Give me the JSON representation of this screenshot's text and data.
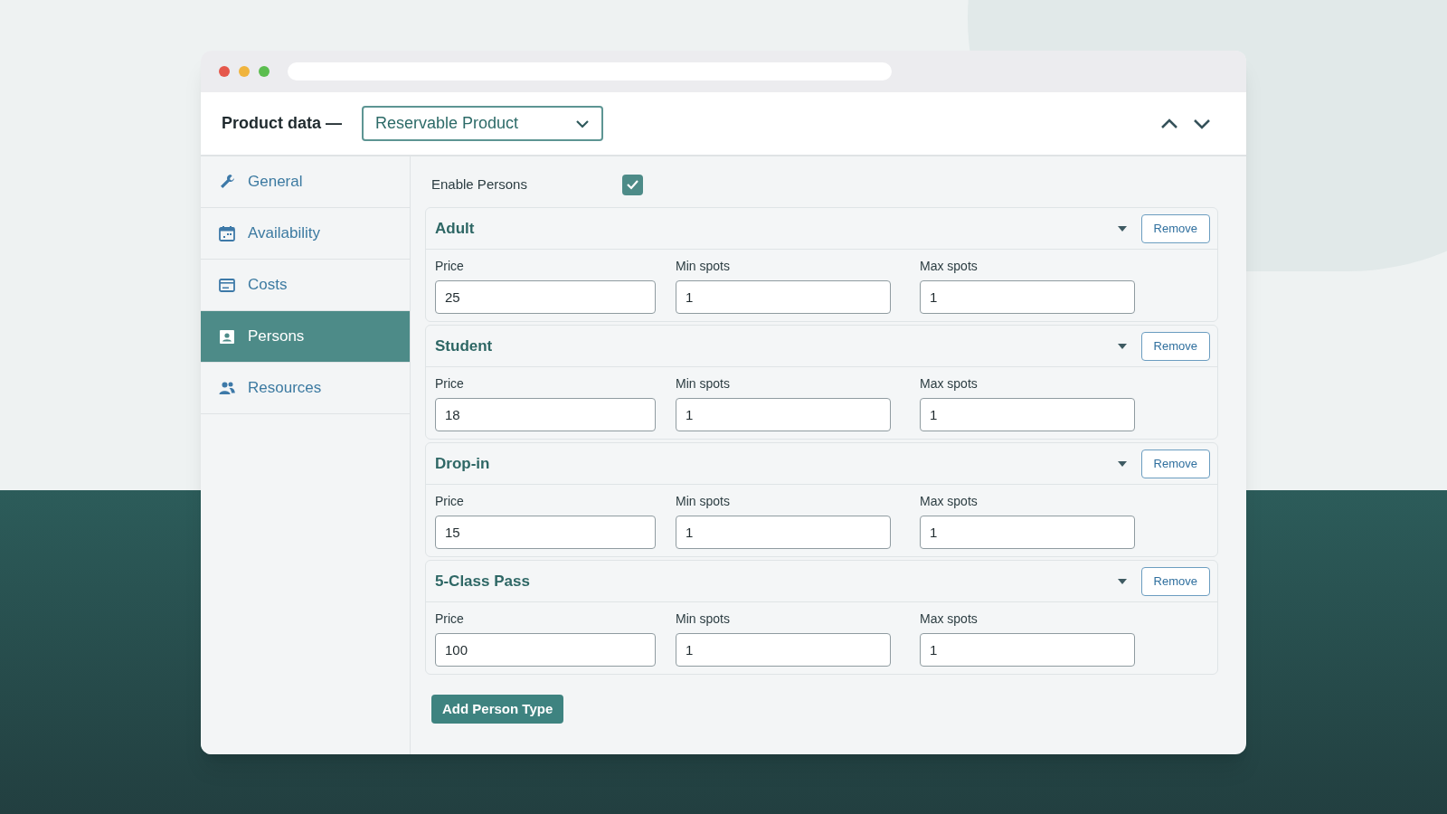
{
  "header": {
    "label": "Product data —",
    "product_type": "Reservable Product"
  },
  "sidebar": {
    "items": [
      {
        "label": "General",
        "selected": false
      },
      {
        "label": "Availability",
        "selected": false
      },
      {
        "label": "Costs",
        "selected": false
      },
      {
        "label": "Persons",
        "selected": true
      },
      {
        "label": "Resources",
        "selected": false
      }
    ]
  },
  "enable_persons": {
    "label": "Enable Persons",
    "checked": true
  },
  "person_types": [
    {
      "name": "Adult",
      "remove": "Remove",
      "fields": [
        {
          "label": "Price",
          "value": "25"
        },
        {
          "label": "Min spots",
          "value": "1"
        },
        {
          "label": "Max spots",
          "value": "1"
        }
      ]
    },
    {
      "name": "Student",
      "remove": "Remove",
      "fields": [
        {
          "label": "Price",
          "value": "18"
        },
        {
          "label": "Min spots",
          "value": "1"
        },
        {
          "label": "Max spots",
          "value": "1"
        }
      ]
    },
    {
      "name": "Drop-in",
      "remove": "Remove",
      "fields": [
        {
          "label": "Price",
          "value": "15"
        },
        {
          "label": "Min spots",
          "value": "1"
        },
        {
          "label": "Max spots",
          "value": "1"
        }
      ]
    },
    {
      "name": "5-Class Pass",
      "remove": "Remove",
      "fields": [
        {
          "label": "Price",
          "value": "100"
        },
        {
          "label": "Min spots",
          "value": "1"
        },
        {
          "label": "Max spots",
          "value": "1"
        }
      ]
    }
  ],
  "add_button": "Add Person Type"
}
